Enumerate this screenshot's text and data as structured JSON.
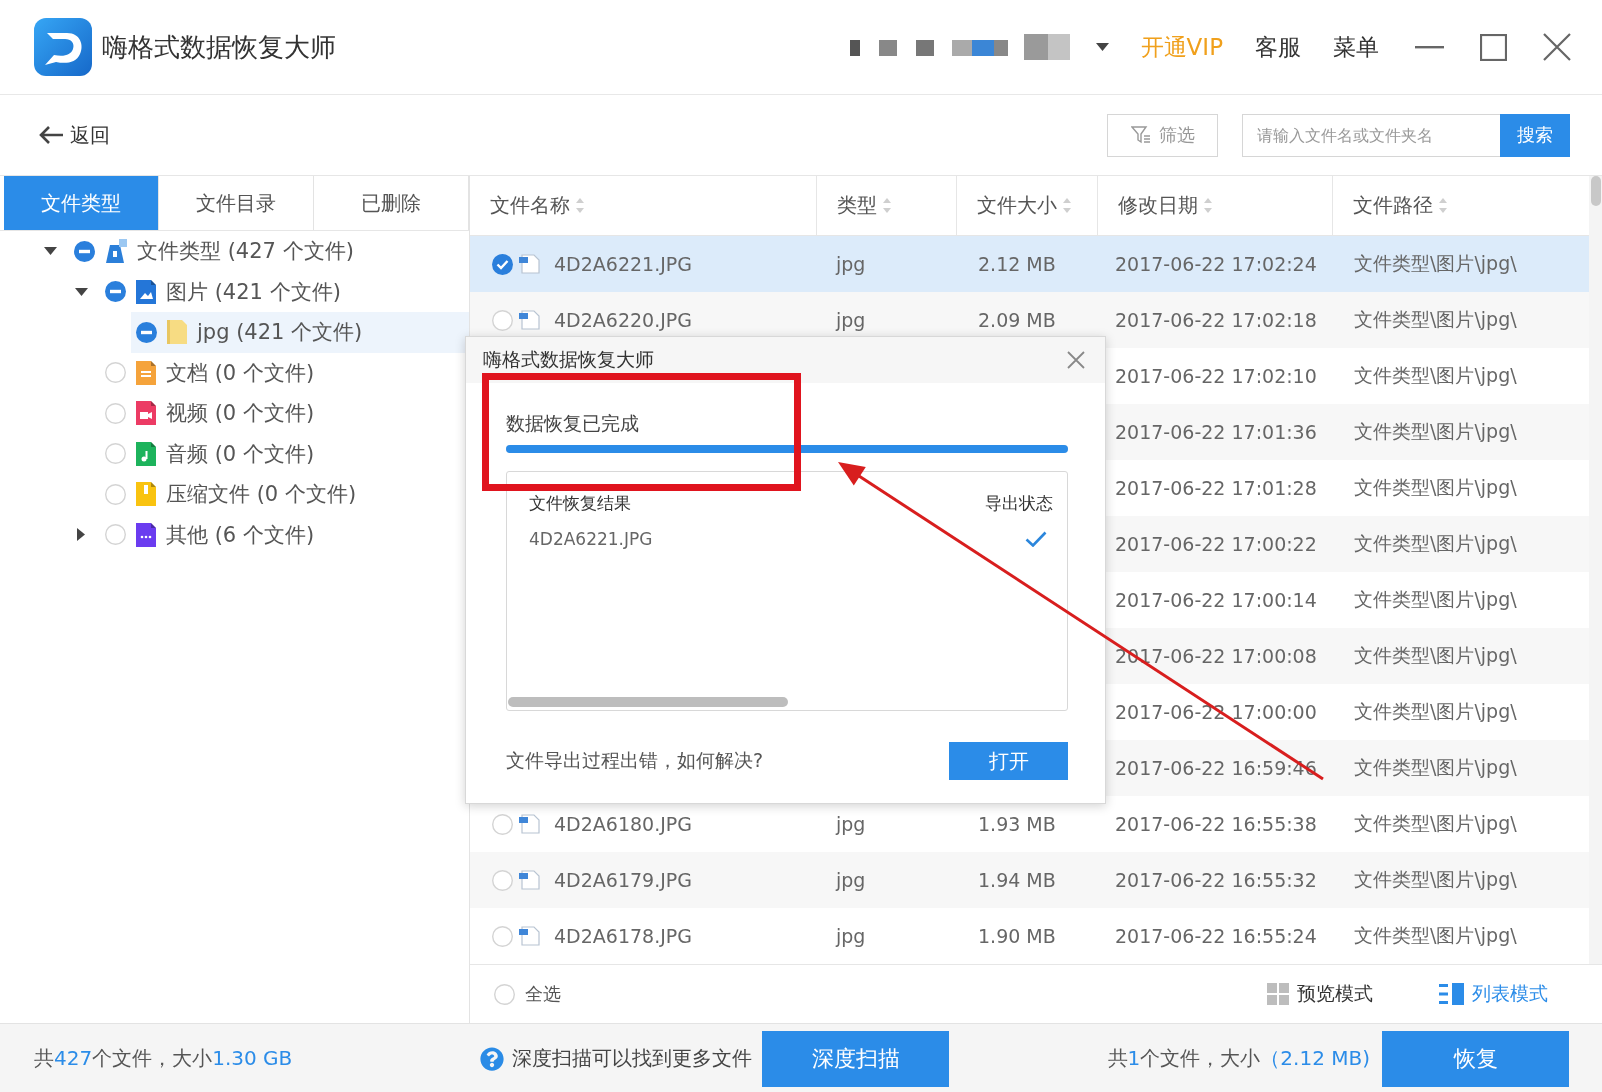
{
  "window": {
    "title": "嗨格式数据恢复大师"
  },
  "title_bar": {
    "links": [
      {
        "label": "开通VIP",
        "kind": "vip"
      },
      {
        "label": "客服",
        "kind": "plain"
      },
      {
        "label": "菜单",
        "kind": "plain"
      }
    ]
  },
  "toolbar": {
    "back": "返回",
    "filter": "筛选",
    "search": {
      "placeholder": "请输入文件名或文件夹名",
      "button": "搜索"
    }
  },
  "sidebar": {
    "tabs": [
      {
        "label": "文件类型",
        "selected": true
      },
      {
        "label": "文件目录",
        "selected": false
      },
      {
        "label": "已删除",
        "selected": false
      }
    ],
    "tree": [
      {
        "label": "文件类型 (427 个文件)",
        "kind": "drive",
        "color": "#2b7fd9",
        "partial": true,
        "expanded": true,
        "selected": false,
        "children": [
          {
            "label": "图片 (421 个文件)",
            "kind": "image",
            "color": "#2476d8",
            "partial": true,
            "expanded": true,
            "selected": false,
            "children": [
              {
                "label": "jpg (421 个文件)",
                "kind": "folder",
                "color": "#f7dc83",
                "partial": true,
                "selected": true
              }
            ]
          },
          {
            "label": "文档 (0 个文件)",
            "kind": "document",
            "color": "#f5a33b",
            "partial": false,
            "selected": false
          },
          {
            "label": "视频 (0 个文件)",
            "kind": "video",
            "color": "#ec3b64",
            "partial": false,
            "selected": false
          },
          {
            "label": "音频 (0 个文件)",
            "kind": "audio",
            "color": "#1db35c",
            "partial": false,
            "selected": false
          },
          {
            "label": "压缩文件 (0 个文件)",
            "kind": "archive",
            "color": "#f9c310",
            "partial": false,
            "selected": false
          },
          {
            "label": "其他 (6 个文件)",
            "kind": "other",
            "color": "#6b3cf0",
            "partial": false,
            "expanded": false,
            "selected": false
          }
        ]
      }
    ]
  },
  "table": {
    "columns": [
      "文件名称",
      "类型",
      "文件大小",
      "修改日期",
      "文件路径"
    ],
    "rows": [
      {
        "name": "4D2A6221.JPG",
        "type": "jpg",
        "size": "2.12 MB",
        "date": "2017-06-22 17:02:24",
        "path": "文件类型\\图片\\jpg\\",
        "selected": true
      },
      {
        "name": "4D2A6220.JPG",
        "type": "jpg",
        "size": "2.09 MB",
        "date": "2017-06-22 17:02:18",
        "path": "文件类型\\图片\\jpg\\",
        "selected": false
      },
      {
        "date": "2017-06-22 17:02:10",
        "path": "文件类型\\图片\\jpg\\",
        "selected": false
      },
      {
        "date": "2017-06-22 17:01:36",
        "path": "文件类型\\图片\\jpg\\",
        "selected": false
      },
      {
        "date": "2017-06-22 17:01:28",
        "path": "文件类型\\图片\\jpg\\",
        "selected": false
      },
      {
        "date": "2017-06-22 17:00:22",
        "path": "文件类型\\图片\\jpg\\",
        "selected": false
      },
      {
        "date": "2017-06-22 17:00:14",
        "path": "文件类型\\图片\\jpg\\",
        "selected": false
      },
      {
        "date": "2017-06-22 17:00:08",
        "path": "文件类型\\图片\\jpg\\",
        "selected": false
      },
      {
        "date": "2017-06-22 17:00:00",
        "path": "文件类型\\图片\\jpg\\",
        "selected": false
      },
      {
        "date": "2017-06-22 16:59:46",
        "path": "文件类型\\图片\\jpg\\",
        "selected": false
      },
      {
        "name": "4D2A6180.JPG",
        "type": "jpg",
        "size": "1.93 MB",
        "date": "2017-06-22 16:55:38",
        "path": "文件类型\\图片\\jpg\\",
        "selected": false
      },
      {
        "name": "4D2A6179.JPG",
        "type": "jpg",
        "size": "1.94 MB",
        "date": "2017-06-22 16:55:32",
        "path": "文件类型\\图片\\jpg\\",
        "selected": false
      },
      {
        "name": "4D2A6178.JPG",
        "type": "jpg",
        "size": "1.90 MB",
        "date": "2017-06-22 16:55:24",
        "path": "文件类型\\图片\\jpg\\",
        "selected": false
      }
    ],
    "footer": {
      "select_all": {
        "label": "全选",
        "checked": false
      },
      "view_modes": [
        {
          "label": "预览模式",
          "kind": "grid",
          "selected": false
        },
        {
          "label": "列表模式",
          "kind": "list",
          "selected": true
        }
      ]
    }
  },
  "dialog": {
    "title": "嗨格式数据恢复大师",
    "status": "数据恢复已完成",
    "progress": {
      "level": 1
    },
    "results": {
      "columns": [
        "文件恢复结果",
        "导出状态"
      ],
      "rows": [
        {
          "name": "4D2A6221.JPG",
          "exported": true
        }
      ]
    },
    "help_link": "文件导出过程出错，如何解决?",
    "button": "打开"
  },
  "status_bar": {
    "total": [
      {
        "text": "共",
        "highlight": false
      },
      {
        "text": "427",
        "highlight": true
      },
      {
        "text": "个文件，大小",
        "highlight": false
      },
      {
        "text": "1.30 GB",
        "highlight": true
      }
    ],
    "hint": "深度扫描可以找到更多文件",
    "scan_button": "深度扫描",
    "selection": [
      {
        "text": "共",
        "highlight": false
      },
      {
        "text": "1",
        "highlight": true
      },
      {
        "text": "个文件，大小",
        "highlight": false
      },
      {
        "text": "（2.12 MB)",
        "highlight": true
      }
    ],
    "recover_button": "恢复"
  }
}
